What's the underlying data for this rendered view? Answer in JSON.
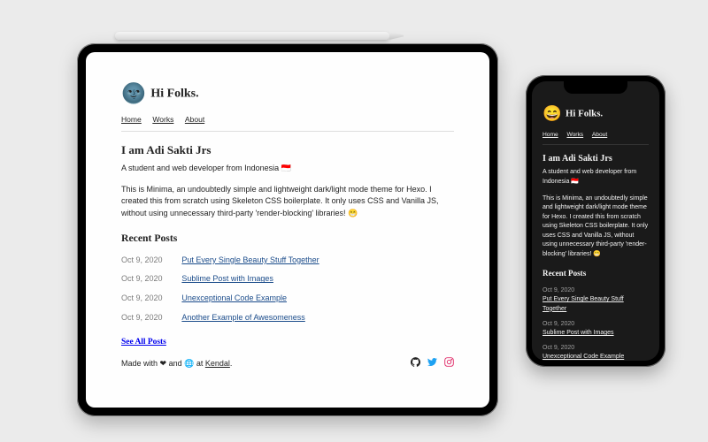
{
  "header": {
    "logo_emoji_light": "🌚",
    "logo_emoji_dark": "😄",
    "title": "Hi Folks."
  },
  "nav": {
    "home": "Home",
    "works": "Works",
    "about": "About"
  },
  "intro": {
    "heading": "I am Adi Sakti Jrs",
    "subtitle": "A student and web developer from Indonesia 🇮🇩",
    "paragraph": "This is Minima, an undoubtedly simple and lightweight dark/light mode theme for Hexo. I created this from scratch using Skeleton CSS boilerplate. It only uses CSS and Vanilla JS, without using unnecessary third-party 'render-blocking' libraries! 😁"
  },
  "recent": {
    "heading": "Recent Posts",
    "posts": [
      {
        "date": "Oct 9, 2020",
        "title": "Put Every Single Beauty Stuff Together"
      },
      {
        "date": "Oct 9, 2020",
        "title": "Sublime Post with Images"
      },
      {
        "date": "Oct 9, 2020",
        "title": "Unexceptional Code Example"
      },
      {
        "date": "Oct 9, 2020",
        "title": "Another Example of Awesomeness"
      }
    ],
    "see_all": "See All Posts"
  },
  "footer": {
    "text_prefix": "Made with ",
    "heart": "❤",
    "and": " and ",
    "coffee": "🌐",
    "at": " at ",
    "location": "Kendal",
    "suffix": "."
  },
  "social": {
    "github": "github-icon",
    "twitter": "twitter-icon",
    "instagram": "instagram-icon"
  }
}
